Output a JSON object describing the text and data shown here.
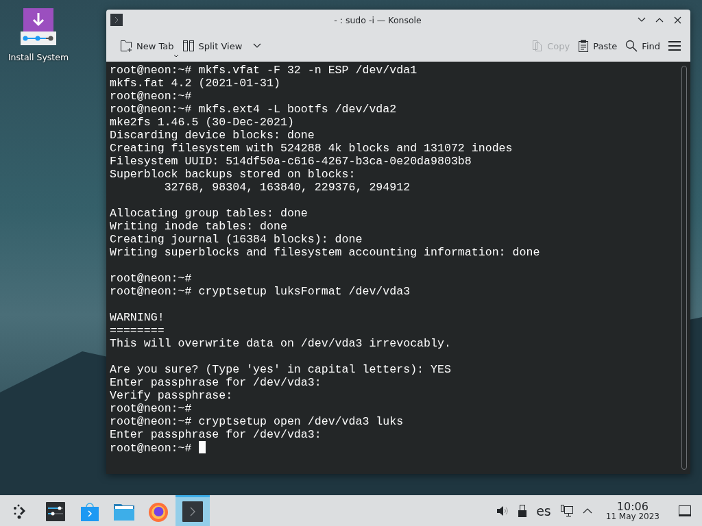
{
  "desktop_icons": [
    {
      "label": "Install System"
    }
  ],
  "window": {
    "title": "- : sudo -i — Konsole"
  },
  "toolbar": {
    "left": [
      {
        "label": "New Tab",
        "kind": "new-tab",
        "disabled": false
      },
      {
        "label": "Split View",
        "kind": "split-view",
        "disabled": false
      }
    ],
    "right": [
      {
        "label": "Copy",
        "kind": "copy",
        "disabled": true
      },
      {
        "label": "Paste",
        "kind": "paste",
        "disabled": false
      },
      {
        "label": "Find",
        "kind": "find",
        "disabled": false
      }
    ]
  },
  "terminal": {
    "lines": [
      {
        "kind": "line",
        "text": "root@neon:~# mkfs.vfat -F 32 -n ESP /dev/vda1"
      },
      {
        "kind": "line",
        "text": "mkfs.fat 4.2 (2021-01-31)"
      },
      {
        "kind": "line",
        "text": "root@neon:~#"
      },
      {
        "kind": "line",
        "text": "root@neon:~# mkfs.ext4 -L bootfs /dev/vda2"
      },
      {
        "kind": "line",
        "text": "mke2fs 1.46.5 (30-Dec-2021)"
      },
      {
        "kind": "line",
        "text": "Discarding device blocks: done"
      },
      {
        "kind": "line",
        "text": "Creating filesystem with 524288 4k blocks and 131072 inodes"
      },
      {
        "kind": "line",
        "text": "Filesystem UUID: 514df50a-c616-4267-b3ca-0e20da9803b8"
      },
      {
        "kind": "line",
        "text": "Superblock backups stored on blocks:"
      },
      {
        "kind": "line",
        "text": "        32768, 98304, 163840, 229376, 294912"
      },
      {
        "kind": "blank"
      },
      {
        "kind": "line",
        "text": "Allocating group tables: done"
      },
      {
        "kind": "line",
        "text": "Writing inode tables: done"
      },
      {
        "kind": "line",
        "text": "Creating journal (16384 blocks): done"
      },
      {
        "kind": "line",
        "text": "Writing superblocks and filesystem accounting information: done"
      },
      {
        "kind": "blank"
      },
      {
        "kind": "line",
        "text": "root@neon:~#"
      },
      {
        "kind": "line",
        "text": "root@neon:~# cryptsetup luksFormat /dev/vda3"
      },
      {
        "kind": "blank"
      },
      {
        "kind": "line",
        "text": "WARNING!"
      },
      {
        "kind": "line",
        "text": "========"
      },
      {
        "kind": "line",
        "text": "This will overwrite data on /dev/vda3 irrevocably."
      },
      {
        "kind": "blank"
      },
      {
        "kind": "line",
        "text": "Are you sure? (Type 'yes' in capital letters): YES"
      },
      {
        "kind": "line",
        "text": "Enter passphrase for /dev/vda3:"
      },
      {
        "kind": "line",
        "text": "Verify passphrase:"
      },
      {
        "kind": "line",
        "text": "root@neon:~#"
      },
      {
        "kind": "line",
        "text": "root@neon:~# cryptsetup open /dev/vda3 luks"
      },
      {
        "kind": "line",
        "text": "Enter passphrase for /dev/vda3:"
      },
      {
        "kind": "prompt",
        "text": "root@neon:~#"
      }
    ]
  },
  "taskbar": {
    "apps": [
      {
        "kind": "launcher",
        "selected": false
      },
      {
        "kind": "settings",
        "selected": false
      },
      {
        "kind": "store",
        "selected": false
      },
      {
        "kind": "files",
        "selected": false
      },
      {
        "kind": "browser",
        "selected": false
      },
      {
        "kind": "terminal",
        "selected": true
      }
    ],
    "keyboard_layout": "es",
    "clock": {
      "time": "10:06",
      "date": "11 May 2023"
    }
  }
}
